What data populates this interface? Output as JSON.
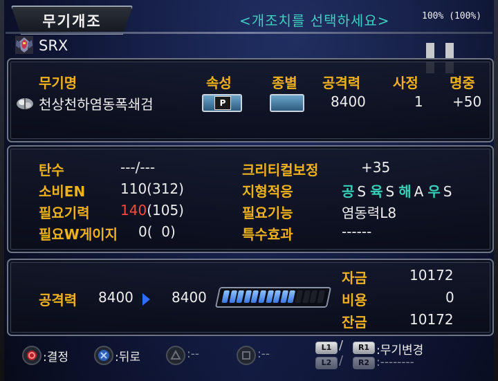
{
  "header": {
    "title": "무기개조",
    "instruction": "<개조치를 선택하세요>",
    "scale": "100% (100%)"
  },
  "robot": {
    "name": "SRX",
    "icon": "robot-portrait-icon"
  },
  "weapon": {
    "columns": [
      "무기명",
      "속성",
      "종별",
      "공격력",
      "사정",
      "명중"
    ],
    "name": "천상천하염동폭쇄검",
    "attribute_badge": "P",
    "attack": "8400",
    "range": "1",
    "accuracy": "+50"
  },
  "stats": {
    "ammo_label": "탄수",
    "ammo_value": "---/---",
    "en_label": "소비EN",
    "en_value": "110(312)",
    "morale_label": "필요기력",
    "morale_value_red": "140",
    "morale_value_rest": "(105)",
    "w_label": "필요W게이지",
    "w_value": "0(  0)",
    "crit_label": "크리티컬보정",
    "crit_value": "+35",
    "terrain_label": "지형적응",
    "terrain": [
      {
        "type": "공",
        "rank": "S"
      },
      {
        "type": "육",
        "rank": "S"
      },
      {
        "type": "해",
        "rank": "A"
      },
      {
        "type": "우",
        "rank": "S"
      }
    ],
    "skill_label": "필요기능",
    "skill_value": "염동력L8",
    "special_label": "특수효과",
    "special_value": "------"
  },
  "upgrade": {
    "label": "공격력",
    "current": "8400",
    "next": "8400",
    "bar_filled": 10,
    "bar_total": 14,
    "funds_label": "자금",
    "funds_value": "10172",
    "cost_label": "비용",
    "cost_value": "0",
    "balance_label": "잔금",
    "balance_value": "10172"
  },
  "controls": {
    "confirm": ":결정",
    "back": ":뒤로",
    "triangle": ":--",
    "square": ":--",
    "l1": "L1",
    "r1": "R1",
    "lr1_action": ":무기변경",
    "l2": "L2",
    "r2": "R2",
    "lr2_action": ":--------"
  },
  "colors": {
    "label": "#f0b21c",
    "terrain": "#36d0b8",
    "warn": "#ff4a3a",
    "bar_fill": "#3a78e0"
  }
}
